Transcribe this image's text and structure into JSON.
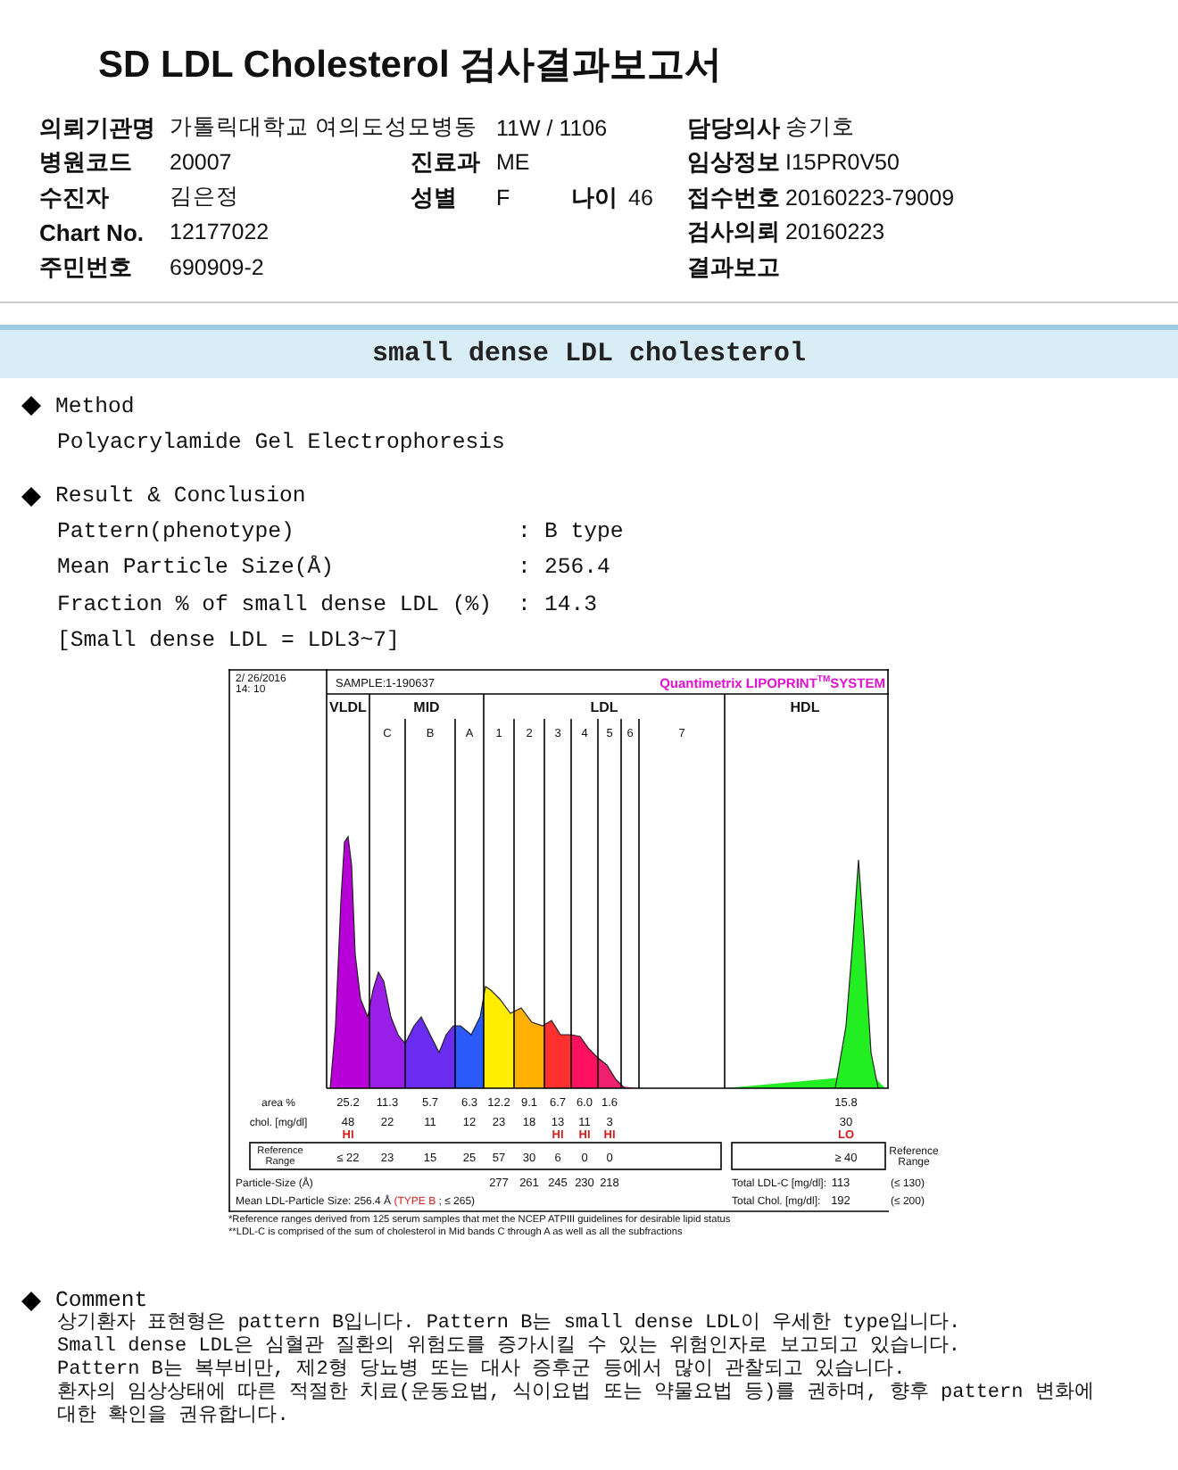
{
  "report": {
    "title": "SD LDL Cholesterol 검사결과보고서"
  },
  "info_rows": [
    {
      "left": {
        "label": "의뢰기관명",
        "value": "가톨릭대학교 여의도성모병동"
      },
      "middle": {
        "value": "11W / 1106"
      },
      "right": {
        "label": "담당의사",
        "value": "송기호"
      }
    },
    {
      "left": {
        "label": "병원코드",
        "value": "20007"
      },
      "middle": {
        "label": "진료과",
        "value": "ME"
      },
      "right": {
        "label": "임상정보",
        "value": "I15PR0V50"
      }
    },
    {
      "left": {
        "label": "수진자",
        "value": "김은정"
      },
      "middle": {
        "label": "성별",
        "value": "F"
      },
      "extra": {
        "label": "나이",
        "value": "46"
      },
      "right": {
        "label": "접수번호",
        "value": "20160223-79009"
      }
    },
    {
      "left": {
        "label": "Chart No.",
        "value": "12177022"
      },
      "right": {
        "label": "검사의뢰",
        "value": "20160223"
      }
    },
    {
      "left": {
        "label": "주민번호",
        "value": "690909-2"
      },
      "right": {
        "label": "결과보고"
      }
    }
  ],
  "section_bar": {
    "title": "small dense LDL cholesterol"
  },
  "method": {
    "heading": "Method",
    "text": "Polyacrylamide Gel Electrophoresis"
  },
  "result": {
    "heading": "Result & Conclusion",
    "rows": [
      {
        "label": "Pattern(phenotype)",
        "separator": ":",
        "value": "B type"
      },
      {
        "label": "Mean Particle Size(Å)",
        "separator": ":",
        "value": "256.4"
      },
      {
        "label": "Fraction % of small dense LDL (%)",
        "separator": ":",
        "value": "14.3"
      }
    ],
    "note": "[Small dense LDL = LDL3~7]"
  },
  "lipoprint": {
    "date": "2/ 26/2016",
    "time": "14: 10",
    "sample_label": "SAMPLE:",
    "sample_id": "1-190637",
    "brand": "Quantimetrix LIPOPRINT$^{TM}$SYSTEM",
    "row_labels": {
      "area": "area %",
      "chol": "chol. [mg/dl]",
      "reference": [
        "Reference",
        "Range"
      ],
      "size": "Particle-Size (Å)"
    },
    "groups": [
      {
        "label": "VLDL",
        "bands": [
          {
            "area": "25.2",
            "chol": "48",
            "flag": "HI",
            "reference": "≤ 22"
          }
        ]
      },
      {
        "label": "MID",
        "bands": [
          {
            "label": "C",
            "area": "11.3",
            "chol": "22",
            "reference": "23"
          },
          {
            "label": "B",
            "area": "5.7",
            "chol": "11",
            "reference": "15"
          },
          {
            "label": "A",
            "area": "6.3",
            "chol": "12",
            "reference": "25"
          }
        ]
      },
      {
        "label": "LDL",
        "bands": [
          {
            "label": "1",
            "area": "12.2",
            "chol": "23",
            "reference": "57",
            "size": "277"
          },
          {
            "label": "2",
            "area": "9.1",
            "chol": "18",
            "reference": "30",
            "size": "261"
          },
          {
            "label": "3",
            "area": "6.7",
            "chol": "13",
            "flag": "HI",
            "reference": "6",
            "size": "245"
          },
          {
            "label": "4",
            "area": "6.0",
            "chol": "11",
            "flag": "HI",
            "reference": "0",
            "size": "230"
          },
          {
            "label": "5",
            "area": "1.6",
            "chol": "3",
            "flag": "HI",
            "reference": "0",
            "size": "218"
          },
          {
            "label": "6"
          },
          {
            "label": "7"
          }
        ]
      },
      {
        "label": "HDL",
        "bands": [
          {
            "area": "15.8",
            "chol": "30",
            "flag": "LO",
            "reference": "≥ 40"
          }
        ]
      }
    ],
    "totals": [
      {
        "label": "Total LDL-C [mg/dl]:",
        "value": "113",
        "reference": "(≤ 130)"
      },
      {
        "label": "Total Chol. [mg/dl]:",
        "value": "192",
        "reference": "(≤ 200)"
      }
    ],
    "totals_reference_label": [
      "Reference",
      "Range"
    ],
    "mean_size": {
      "label": "Mean LDL-Particle Size:",
      "value": "256.4 Å",
      "type": "(TYPE B",
      "detail": "; ≤ 265)"
    },
    "footnotes": [
      "*Reference ranges derived from 125 serum samples that met the NCEP ATPIII guidelines for desirable lipid status",
      "**LDL-C is comprised of the sum of cholesterol in Mid bands C through A as well as all the subfractions"
    ]
  },
  "comment": {
    "heading": "Comment",
    "lines": [
      "상기환자 표현형은 pattern B입니다. Pattern B는 small dense LDL이 우세한 type입니다.",
      "Small dense LDL은 심혈관 질환의 위험도를 증가시킬 수 있는 위험인자로 보고되고 있습니다.",
      "Pattern B는 복부비만, 제2형 당뇨병 또는 대사 증후군 등에서 많이 관찰되고 있습니다.",
      "환자의 임상상태에 따른 적절한 치료(운동요법, 식이요법 또는 약물요법 등)를 권하며, 향후 pattern 변화에",
      "대한 확인을 권유합니다."
    ]
  }
}
